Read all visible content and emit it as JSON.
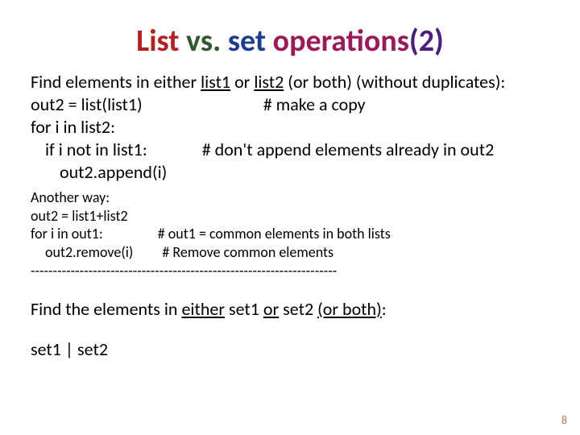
{
  "title": {
    "list": "List",
    "vs": " vs.",
    "set": " set",
    "ops": " operations",
    "paren": "(2)"
  },
  "body1": {
    "find_a": "Find elements in either ",
    "list1": "list1",
    "or": " or ",
    "list2": "list2",
    "find_b": " (or both) (without duplicates):",
    "l2a": "out2 = list(list1)",
    "l2b": "# make a copy",
    "l3": "for i in list2:",
    "l4a": "if i not in list1:",
    "l4b": "# don't append elements already in out2",
    "l5": "out2.append(i)"
  },
  "body2": {
    "l1": "Another way:",
    "l2": "out2 = list1+list2",
    "l3a": "for i in out1:",
    "l3b": "# out1 = common elements in both lists",
    "l4a": "out2.remove(i)",
    "l4b": "# Remove common elements"
  },
  "sep": "---------------------------------------------------------------------",
  "body3": {
    "a": "Find the elements in ",
    "e1": "either",
    "s1_a": " set1 ",
    "or": "or",
    "s2_a": " set2 ",
    "b": "(or both)",
    "colon": ":",
    "line2": "set1 | set2"
  },
  "page": "8"
}
